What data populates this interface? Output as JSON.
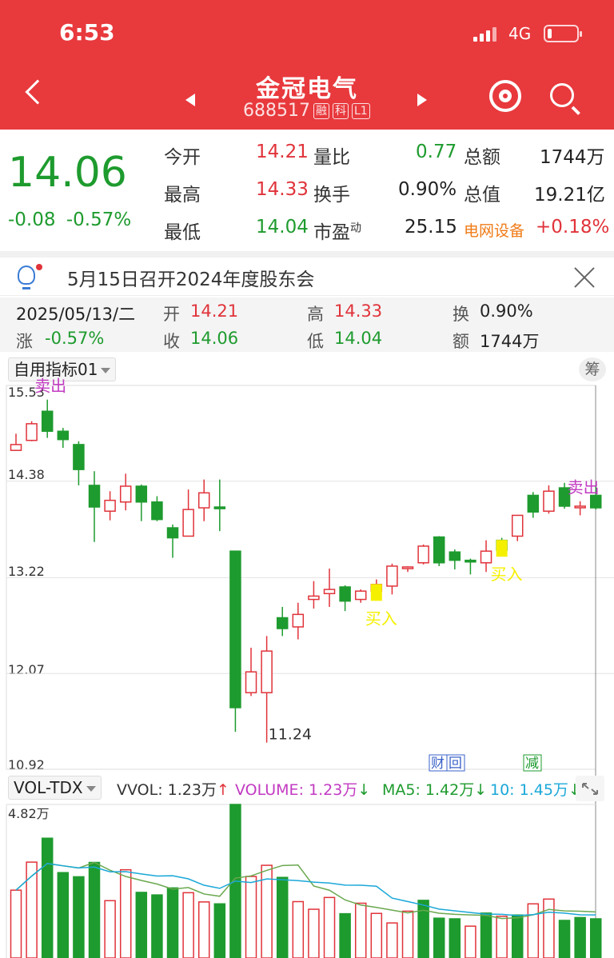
{
  "status": {
    "time": "6:53",
    "network": "4G"
  },
  "header": {
    "name": "金冠电气",
    "code": "688517",
    "tag_rong": "融",
    "tag_ke": "科",
    "tag_level": "L1"
  },
  "quote": {
    "price": "14.06",
    "change": "-0.08",
    "change_pct": "-0.57%",
    "fields": [
      {
        "label": "今开",
        "value": "14.21"
      },
      {
        "label": "量比",
        "value": "0.77"
      },
      {
        "label": "总额",
        "value": "1744万"
      },
      {
        "label": "最高",
        "value": "14.33"
      },
      {
        "label": "换手",
        "value": "0.90%"
      },
      {
        "label": "总值",
        "value": "19.21亿"
      },
      {
        "label": "最低",
        "value": "14.04"
      },
      {
        "label": "市盈",
        "value": "25.15",
        "sup": "动"
      }
    ],
    "sector": {
      "name": "电网设备",
      "change": "+0.18%"
    }
  },
  "notice": {
    "text": "5月15日召开2024年度股东会"
  },
  "day_info": {
    "date": "2025/05/13/二",
    "open_label": "开",
    "open": "14.21",
    "high_label": "高",
    "high": "14.33",
    "turnover_label": "换",
    "turnover": "0.90%",
    "change_label": "涨",
    "change": "-0.57%",
    "close_label": "收",
    "close": "14.06",
    "low_label": "低",
    "low": "14.04",
    "amount_label": "额",
    "amount": "1744万"
  },
  "kline": {
    "indicator": "自用指标01",
    "chip_button": "筹",
    "y_labels": [
      "15.53",
      "14.38",
      "13.22",
      "12.07",
      "10.92"
    ],
    "low_marker": "11.24",
    "events": {
      "financial": "财",
      "return": "回",
      "reduce": "减"
    },
    "signal_sell": "卖出",
    "signal_buy": "买入"
  },
  "volume": {
    "indicator": "VOL-TDX",
    "vvol": "VVOL: 1.23万",
    "volume": "VOLUME: 1.23万",
    "ma5": "MA5: 1.42万",
    "ma10": "10: 1.45万",
    "max_label": "4.82万"
  },
  "colors": {
    "up": "#e0333a",
    "down": "#1e9b2e",
    "header": "#e8393d",
    "buy": "#f5f000",
    "sell": "#c23ac2"
  },
  "chart_data": {
    "type": "candlestick",
    "ylim": [
      10.92,
      15.53
    ],
    "candles": [
      {
        "o": 14.75,
        "c": 14.82,
        "h": 14.95,
        "l": 14.75,
        "dir": "up"
      },
      {
        "o": 14.87,
        "c": 15.07,
        "h": 15.1,
        "l": 14.86,
        "dir": "up"
      },
      {
        "o": 15.22,
        "c": 14.98,
        "h": 15.36,
        "l": 14.9,
        "dir": "down"
      },
      {
        "o": 14.98,
        "c": 14.88,
        "h": 15.02,
        "l": 14.78,
        "dir": "down"
      },
      {
        "o": 14.82,
        "c": 14.52,
        "h": 14.86,
        "l": 14.33,
        "dir": "down"
      },
      {
        "o": 14.33,
        "c": 14.07,
        "h": 14.5,
        "l": 13.65,
        "dir": "down"
      },
      {
        "o": 14.02,
        "c": 14.15,
        "h": 14.26,
        "l": 13.91,
        "dir": "up"
      },
      {
        "o": 14.13,
        "c": 14.32,
        "h": 14.47,
        "l": 14.03,
        "dir": "up"
      },
      {
        "o": 14.32,
        "c": 14.13,
        "h": 14.34,
        "l": 13.9,
        "dir": "down"
      },
      {
        "o": 14.13,
        "c": 13.92,
        "h": 14.2,
        "l": 13.9,
        "dir": "down"
      },
      {
        "o": 13.82,
        "c": 13.7,
        "h": 13.86,
        "l": 13.46,
        "dir": "down"
      },
      {
        "o": 13.72,
        "c": 14.04,
        "h": 14.28,
        "l": 13.72,
        "dir": "up"
      },
      {
        "o": 14.06,
        "c": 14.24,
        "h": 14.4,
        "l": 13.9,
        "dir": "up"
      },
      {
        "o": 14.07,
        "c": 14.05,
        "h": 14.4,
        "l": 13.78,
        "dir": "down"
      },
      {
        "o": 13.54,
        "c": 11.66,
        "h": 13.54,
        "l": 11.37,
        "dir": "down"
      },
      {
        "o": 11.84,
        "c": 12.09,
        "h": 12.38,
        "l": 11.8,
        "dir": "up"
      },
      {
        "o": 11.84,
        "c": 12.34,
        "h": 12.52,
        "l": 11.24,
        "dir": "up"
      },
      {
        "o": 12.74,
        "c": 12.61,
        "h": 12.87,
        "l": 12.52,
        "dir": "down"
      },
      {
        "o": 12.63,
        "c": 12.78,
        "h": 12.92,
        "l": 12.48,
        "dir": "up"
      },
      {
        "o": 12.96,
        "c": 13.0,
        "h": 13.18,
        "l": 12.85,
        "dir": "up"
      },
      {
        "o": 13.03,
        "c": 13.08,
        "h": 13.33,
        "l": 12.87,
        "dir": "up"
      },
      {
        "o": 13.11,
        "c": 12.94,
        "h": 13.13,
        "l": 12.82,
        "dir": "down"
      },
      {
        "o": 12.96,
        "c": 13.06,
        "h": 13.08,
        "l": 12.92,
        "dir": "up"
      },
      {
        "o": 13.06,
        "c": 13.14,
        "h": 13.2,
        "l": 13.01,
        "dir": "up"
      },
      {
        "o": 13.12,
        "c": 13.36,
        "h": 13.39,
        "l": 13.02,
        "dir": "up"
      },
      {
        "o": 13.33,
        "c": 13.35,
        "h": 13.36,
        "l": 13.29,
        "dir": "up"
      },
      {
        "o": 13.4,
        "c": 13.6,
        "h": 13.62,
        "l": 13.38,
        "dir": "up"
      },
      {
        "o": 13.71,
        "c": 13.4,
        "h": 13.72,
        "l": 13.36,
        "dir": "down"
      },
      {
        "o": 13.53,
        "c": 13.43,
        "h": 13.56,
        "l": 13.32,
        "dir": "down"
      },
      {
        "o": 13.43,
        "c": 13.41,
        "h": 13.45,
        "l": 13.26,
        "dir": "down"
      },
      {
        "o": 13.4,
        "c": 13.54,
        "h": 13.67,
        "l": 13.29,
        "dir": "up"
      },
      {
        "o": 13.67,
        "c": 13.55,
        "h": 13.7,
        "l": 13.54,
        "dir": "down"
      },
      {
        "o": 13.72,
        "c": 13.97,
        "h": 13.97,
        "l": 13.66,
        "dir": "up"
      },
      {
        "o": 14.21,
        "c": 14.01,
        "h": 14.25,
        "l": 13.94,
        "dir": "down"
      },
      {
        "o": 14.02,
        "c": 14.26,
        "h": 14.33,
        "l": 13.99,
        "dir": "up"
      },
      {
        "o": 14.3,
        "c": 14.08,
        "h": 14.36,
        "l": 14.05,
        "dir": "down"
      },
      {
        "o": 14.08,
        "c": 14.07,
        "h": 14.14,
        "l": 13.97,
        "dir": "up"
      },
      {
        "o": 14.21,
        "c": 14.06,
        "h": 14.33,
        "l": 14.04,
        "dir": "down"
      }
    ],
    "volume_ylim": [
      0,
      4.82
    ],
    "volumes": [
      {
        "v": 2.13,
        "dir": "up"
      },
      {
        "v": 3.01,
        "dir": "up"
      },
      {
        "v": 3.76,
        "dir": "down"
      },
      {
        "v": 2.68,
        "dir": "down"
      },
      {
        "v": 2.55,
        "dir": "down"
      },
      {
        "v": 3.0,
        "dir": "down"
      },
      {
        "v": 1.8,
        "dir": "up"
      },
      {
        "v": 2.77,
        "dir": "up"
      },
      {
        "v": 2.06,
        "dir": "down"
      },
      {
        "v": 1.98,
        "dir": "down"
      },
      {
        "v": 2.2,
        "dir": "down"
      },
      {
        "v": 2.05,
        "dir": "up"
      },
      {
        "v": 1.76,
        "dir": "up"
      },
      {
        "v": 1.7,
        "dir": "down"
      },
      {
        "v": 4.82,
        "dir": "down"
      },
      {
        "v": 2.56,
        "dir": "up"
      },
      {
        "v": 2.91,
        "dir": "up"
      },
      {
        "v": 2.53,
        "dir": "down"
      },
      {
        "v": 1.77,
        "dir": "up"
      },
      {
        "v": 1.53,
        "dir": "up"
      },
      {
        "v": 1.9,
        "dir": "up"
      },
      {
        "v": 1.39,
        "dir": "down"
      },
      {
        "v": 1.72,
        "dir": "up"
      },
      {
        "v": 1.4,
        "dir": "up"
      },
      {
        "v": 1.1,
        "dir": "up"
      },
      {
        "v": 1.47,
        "dir": "up"
      },
      {
        "v": 1.81,
        "dir": "down"
      },
      {
        "v": 1.25,
        "dir": "down"
      },
      {
        "v": 1.23,
        "dir": "down"
      },
      {
        "v": 1.0,
        "dir": "up"
      },
      {
        "v": 1.41,
        "dir": "down"
      },
      {
        "v": 1.31,
        "dir": "up"
      },
      {
        "v": 1.35,
        "dir": "down"
      },
      {
        "v": 1.7,
        "dir": "up"
      },
      {
        "v": 1.85,
        "dir": "up"
      },
      {
        "v": 1.18,
        "dir": "down"
      },
      {
        "v": 1.27,
        "dir": "down"
      },
      {
        "v": 1.23,
        "dir": "down"
      }
    ],
    "signals": [
      {
        "index": 2,
        "type": "sell"
      },
      {
        "index": 23,
        "type": "buy"
      },
      {
        "index": 31,
        "type": "buy"
      },
      {
        "index": 36,
        "type": "sell"
      }
    ]
  }
}
